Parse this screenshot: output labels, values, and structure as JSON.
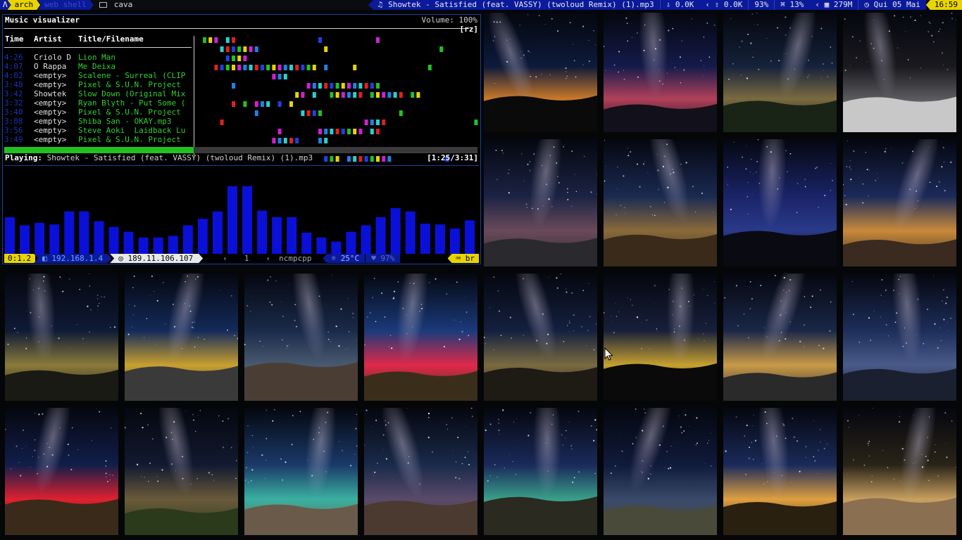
{
  "topbar": {
    "workspaces": [
      {
        "label": "arch",
        "state": "active"
      },
      {
        "label": "web shell",
        "state": "dim"
      },
      {
        "label": "cava",
        "state": "current"
      }
    ],
    "now_playing": "Showtek - Satisfied (feat. VASSY) (twoloud Remix) (1).mp3",
    "net_down": "0.0K",
    "net_up": "0.0K",
    "battery": "93%",
    "cpu": "13%",
    "memory": "279M",
    "date": "Qui 05 Mai",
    "time": "16:59"
  },
  "terminal": {
    "title": "Music visualizer",
    "volume": "Volume: 100%",
    "mode_tag": "[rz]",
    "columns": {
      "time": "Time",
      "artist": "Artist",
      "title": "Title/Filename"
    },
    "playlist": [
      {
        "time": "4:26",
        "artist": "Criolo D",
        "title": "Lion Man"
      },
      {
        "time": "4:07",
        "artist": "O Rappa",
        "title": "Me Deixa"
      },
      {
        "time": "4:02",
        "artist": "<empty>",
        "title": "Scalene - Surreal (CLIP"
      },
      {
        "time": "3:48",
        "artist": "<empty>",
        "title": "Pixel & S.U.N. Project"
      },
      {
        "time": "3:42",
        "artist": "Showtek",
        "title": "Slow Down (Original Mix"
      },
      {
        "time": "3:32",
        "artist": "<empty>",
        "title": "Ryan Blyth - Put Some ("
      },
      {
        "time": "3:40",
        "artist": "<empty>",
        "title": "Pixel & S.U.N. Project"
      },
      {
        "time": "3:08",
        "artist": "<empty>",
        "title": "Shiba San - OKAY.mp3"
      },
      {
        "time": "3:56",
        "artist": "<empty>",
        "title": "Steve Aoki  Laidback Lu"
      },
      {
        "time": "3:49",
        "artist": "<empty>",
        "title": "Pixel & S.U.N. Project"
      }
    ],
    "playing_label": "Playing:",
    "playing_track": "Showtek - Satisfied (feat. VASSY) (twoloud Remix) (1).mp3",
    "elapsed": "[1:25/3:31]",
    "progress": 0.4,
    "spectrum_levels": [
      0.45,
      0.35,
      0.38,
      0.36,
      0.52,
      0.52,
      0.4,
      0.33,
      0.27,
      0.2,
      0.2,
      0.22,
      0.35,
      0.43,
      0.52,
      0.83,
      0.83,
      0.53,
      0.45,
      0.45,
      0.26,
      0.2,
      0.15,
      0.27,
      0.35,
      0.45,
      0.56,
      0.52,
      0.37,
      0.36,
      0.31,
      0.41
    ],
    "status": {
      "version": "0:1.2",
      "lan_ip": "192.168.1.4",
      "wan_ip": "189.11.106.107",
      "window": "1",
      "program": "ncmpcpp",
      "temp": "25°C",
      "battery": "97%",
      "layout": "br"
    }
  },
  "gallery": {
    "tiles": [
      {
        "name": "tile-ibex-silhouettes",
        "sky": "#0d1a3a",
        "glow": "#c8782a",
        "ground": "#0a0a0a"
      },
      {
        "name": "tile-light-painting-scorpion",
        "sky": "#141b4a",
        "glow": "#b0405a",
        "ground": "#12101a"
      },
      {
        "name": "tile-milky-way-arch-hills",
        "sky": "#15223a",
        "glow": "#7a6a40",
        "ground": "#1a2416"
      },
      {
        "name": "tile-rock-arch-night",
        "sky": "#1a1a1e",
        "glow": "#5a5a5e",
        "ground": "#c8c8c8"
      },
      {
        "name": "tile-boardwalk-lake",
        "sky": "#1b2344",
        "glow": "#6a4a5a",
        "ground": "#2a2a2e"
      },
      {
        "name": "tile-rock-spire",
        "sky": "#1a2a52",
        "glow": "#8a6a3a",
        "ground": "#3a2a1a"
      },
      {
        "name": "tile-starry-horses",
        "sky": "#1a2468",
        "glow": "#2a3a8a",
        "ground": "#0a0a12"
      },
      {
        "name": "tile-desert-road-arch",
        "sky": "#1c2a5a",
        "glow": "#c88a3a",
        "ground": "#3a2a20"
      },
      {
        "name": "tile-observatory-dome",
        "sky": "#0f1a36",
        "glow": "#8a7a3a",
        "ground": "#1a1a14"
      },
      {
        "name": "tile-valley-lights",
        "sky": "#142a5a",
        "glow": "#c8a030",
        "ground": "#3a3a3a"
      },
      {
        "name": "tile-dirt-road-sky",
        "sky": "#1a2a4a",
        "glow": "#4a5a70",
        "ground": "#4a3e34"
      },
      {
        "name": "tile-star-trails-dome",
        "sky": "#1a3a7a",
        "glow": "#e02a4a",
        "ground": "#3a2e1a"
      },
      {
        "name": "tile-laser-person",
        "sky": "#142040",
        "glow": "#7a6a40",
        "ground": "#1e1a14"
      },
      {
        "name": "tile-milky-way-horizon",
        "sky": "#17203a",
        "glow": "#c8a030",
        "ground": "#0a0a0a"
      },
      {
        "name": "tile-abandoned-station",
        "sky": "#1a2748",
        "glow": "#c89a48",
        "ground": "#2a2a2a"
      },
      {
        "name": "tile-lake-dock",
        "sky": "#1e2e5a",
        "glow": "#4a5a8a",
        "ground": "#1a2030"
      },
      {
        "name": "tile-wind-turbines",
        "sky": "#121e4a",
        "glow": "#e02030",
        "ground": "#3a2a1a"
      },
      {
        "name": "tile-mountain-shrubs",
        "sky": "#121a30",
        "glow": "#6a5a3a",
        "ground": "#2a3a1a"
      },
      {
        "name": "tile-bristlecone-pine",
        "sky": "#1a3a6a",
        "glow": "#3ab0a0",
        "ground": "#6a5a4a"
      },
      {
        "name": "tile-twisted-tree",
        "sky": "#1a2a4a",
        "glow": "#5a4a6a",
        "ground": "#4a3a30"
      },
      {
        "name": "tile-yosemite-aurora",
        "sky": "#1a2a5a",
        "glow": "#3aa08a",
        "ground": "#2a2a20"
      },
      {
        "name": "tile-dinosaur-statue",
        "sky": "#101a3a",
        "glow": "#3a4a6a",
        "ground": "#4a4a3a"
      },
      {
        "name": "tile-wooden-ruins",
        "sky": "#1a2a5a",
        "glow": "#e0a040",
        "ground": "#2a2010"
      },
      {
        "name": "tile-desert-shadow",
        "sky": "#2a2418",
        "glow": "#c8a060",
        "ground": "#8a7050"
      }
    ]
  }
}
